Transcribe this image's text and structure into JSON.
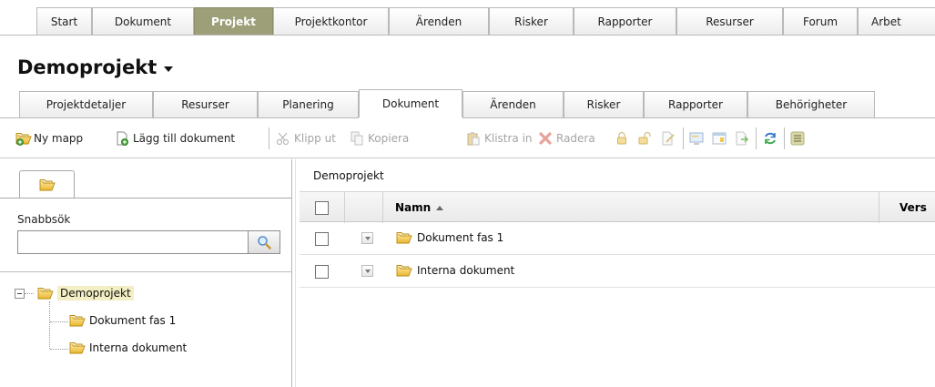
{
  "top_tabs": [
    {
      "label": "Start"
    },
    {
      "label": "Dokument"
    },
    {
      "label": "Projekt"
    },
    {
      "label": "Projektkontor"
    },
    {
      "label": "Ärenden"
    },
    {
      "label": "Risker"
    },
    {
      "label": "Rapporter"
    },
    {
      "label": "Resurser"
    },
    {
      "label": "Forum"
    },
    {
      "label": "Arbet"
    }
  ],
  "project_title": "Demoprojekt",
  "sub_tabs": [
    {
      "label": "Projektdetaljer"
    },
    {
      "label": "Resurser"
    },
    {
      "label": "Planering"
    },
    {
      "label": "Dokument"
    },
    {
      "label": "Ärenden"
    },
    {
      "label": "Risker"
    },
    {
      "label": "Rapporter"
    },
    {
      "label": "Behörigheter"
    }
  ],
  "toolbar": {
    "new_folder": "Ny mapp",
    "add_document": "Lägg till dokument",
    "cut": "Klipp ut",
    "copy": "Kopiera",
    "paste": "Klistra in",
    "delete": "Radera"
  },
  "quick_search": {
    "label": "Snabbsök",
    "value": ""
  },
  "tree": {
    "root": "Demoprojekt",
    "children": [
      "Dokument fas 1",
      "Interna dokument"
    ]
  },
  "breadcrumb": "Demoprojekt",
  "grid": {
    "col_name": "Namn",
    "col_version": "Vers",
    "rows": [
      {
        "name": "Dokument fas 1"
      },
      {
        "name": "Interna dokument"
      }
    ]
  },
  "colors": {
    "active_tab": "#9c9f77",
    "folder": "#f2c94c",
    "tree_selected": "#f3efc4"
  }
}
